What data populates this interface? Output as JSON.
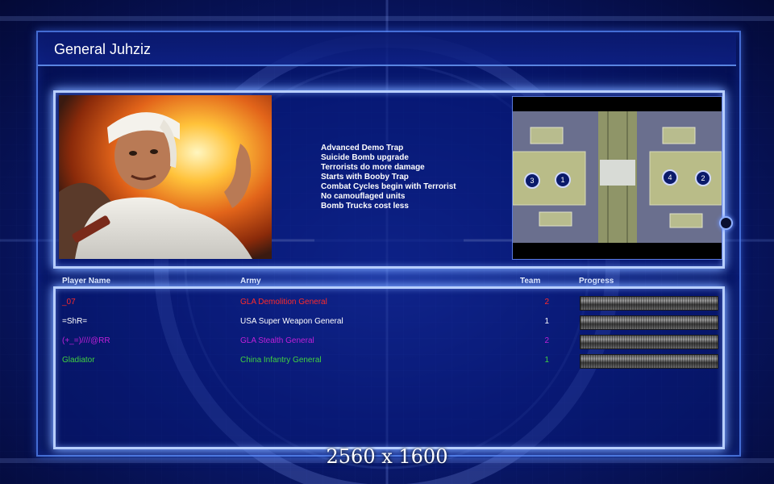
{
  "header": {
    "title": "General Juhziz"
  },
  "general": {
    "features": [
      "Advanced Demo Trap",
      "Suicide Bomb upgrade",
      "Terrorists do more damage",
      "Starts with Booby Trap",
      "Combat Cycles begin with Terrorist",
      "No camouflaged units",
      "Bomb Trucks cost less"
    ]
  },
  "minimap": {
    "markers": [
      "3",
      "1",
      "4",
      "2"
    ]
  },
  "players": {
    "headers": {
      "name": "Player Name",
      "army": "Army",
      "team": "Team",
      "progress": "Progress"
    },
    "rows": [
      {
        "name": "_07",
        "army": "GLA Demolition General",
        "team": "2",
        "color": "#ff2a2a"
      },
      {
        "name": "=ShR=",
        "army": "USA Super Weapon General",
        "team": "1",
        "color": "#ffffff"
      },
      {
        "name": "(+_=)////@RR",
        "army": "GLA Stealth General",
        "team": "2",
        "color": "#c020d8"
      },
      {
        "name": "Gladiator",
        "army": "China Infantry General",
        "team": "1",
        "color": "#40d040"
      }
    ]
  },
  "footer": {
    "resolution": "2560 x 1600"
  }
}
